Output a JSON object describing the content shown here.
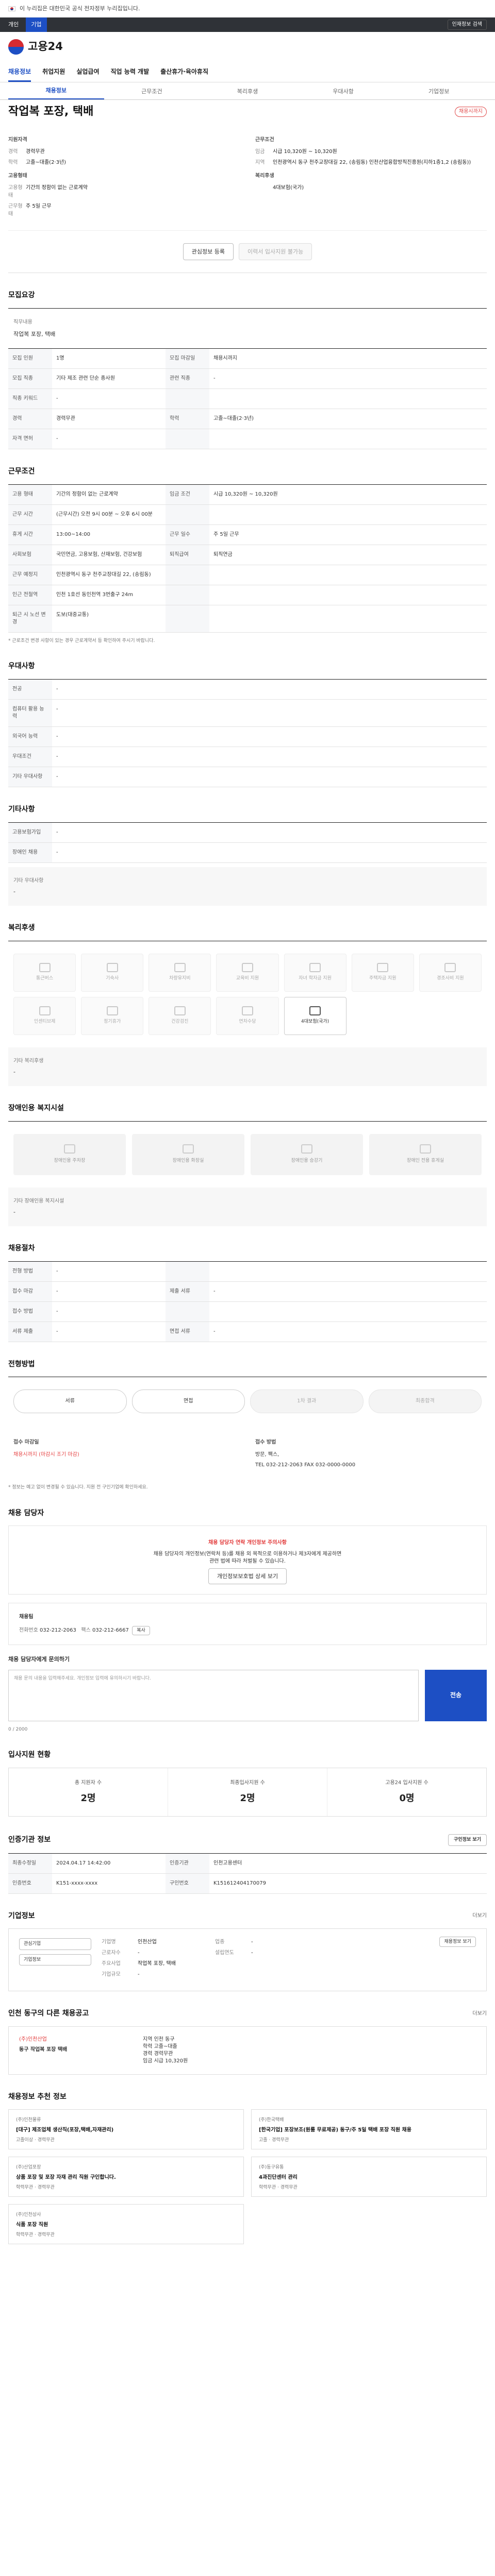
{
  "gov_banner": {
    "text": "이 누리집은 대한민국 공식 전자정부 누리집입니다.",
    "more": "",
    "right": ""
  },
  "util": {
    "tab1": "개인",
    "tab2": "기업",
    "chip": "인재정보 검색"
  },
  "logo": "고용24",
  "gnb": [
    "채용정보",
    "취업지원",
    "실업급여",
    "직업 능력 개발",
    "출산휴가·육아휴직"
  ],
  "subtabs": [
    "채용정보",
    "근무조건",
    "복리후생",
    "우대사항",
    "기업정보"
  ],
  "posting": {
    "title": "작업복 포장, 택배",
    "badge": "채용시까지"
  },
  "summary": {
    "left_h": "지원자격",
    "rows_left": [
      [
        "경력",
        "경력무관"
      ],
      [
        "학력",
        "고졸~대졸(2·3년)"
      ]
    ],
    "left_h2": "고용형태",
    "rows_left2": [
      [
        "고용형태",
        "기간의 정함이 없는 근로계약"
      ],
      [
        "근무형태",
        "주 5일 근무"
      ]
    ],
    "right_h": "근무조건",
    "rows_right": [
      [
        "임금",
        "시급 10,320원 ~ 10,320원"
      ],
      [
        "지역",
        "인천광역시 동구 천주교장대길 22, (송림동) 인천산업융합방직진흥원(지하1층1,2 (송림동))"
      ]
    ],
    "right_h2": "복리후생",
    "rows_right2": [
      [
        "",
        "4대보험(국가)"
      ]
    ]
  },
  "buttons": {
    "save": "관심정보 등록",
    "apply": "이력서 입사지원 불가능"
  },
  "sec_detail": {
    "h": "모집요강",
    "k": "직무내용",
    "v": "작업복 포장, 택배"
  },
  "recruit_table": [
    [
      "모집 인원",
      "1명",
      "모집 마감일",
      "채용시까지"
    ],
    [
      "모집 직종",
      "기타 제조 관련 단순 종사원",
      "관련 직종",
      "-"
    ],
    [
      "직종 키워드",
      "-",
      "",
      ""
    ],
    [
      "경력",
      "경력무관",
      "학력",
      "고졸~대졸(2·3년)"
    ],
    [
      "자격 면허",
      "-",
      "",
      ""
    ]
  ],
  "sec_cond": {
    "h": "근무조건"
  },
  "cond_table": [
    [
      "고용 형태",
      "기간의 정함이 없는 근로계약",
      "임금 조건",
      "시급 10,320원 ~ 10,320원"
    ],
    [
      "근무 시간",
      "(근무시간) 오전 9시 00분 ~ 오후 6시 00분",
      "",
      ""
    ],
    [
      "휴게 시간",
      "13:00~14:00",
      "근무 일수",
      "주 5일 근무"
    ],
    [
      "사회보험",
      "국민연금, 고용보험, 산재보험, 건강보험",
      "퇴직급여",
      "퇴직연금"
    ],
    [
      "근무 예정지",
      "인천광역시 동구 천주교장대길 22, (송림동)",
      "",
      ""
    ],
    [
      "인근 전철역",
      "인천 1호선 동인천역 3번출구 24m",
      "",
      ""
    ],
    [
      "퇴근 시 노선 변경",
      "도보(대중교통)",
      "",
      ""
    ]
  ],
  "cond_note": "* 근로조건 변경 사항이 있는 경우 근로계약서 등 확인하여 주시기 바랍니다.",
  "sec_pref": {
    "h": "우대사항"
  },
  "pref_table": [
    [
      "전공",
      "-"
    ],
    [
      "컴퓨터 활용 능력",
      "-"
    ],
    [
      "외국어 능력",
      "-"
    ],
    [
      "우대조건",
      "-"
    ],
    [
      "기타 우대사항",
      "-"
    ]
  ],
  "sec_etc": {
    "h": "기타사항"
  },
  "etc_table": [
    [
      "고용보험가입",
      "-"
    ],
    [
      "장애인 채용",
      "-"
    ]
  ],
  "etc_box": {
    "k": "기타 우대사항",
    "v": "-"
  },
  "sec_welfare": {
    "h": "복리후생"
  },
  "welfare_items": [
    "통근버스",
    "기숙사",
    "차량유지비",
    "교육비 지원",
    "자녀 학자금 지원",
    "주택자금 지원",
    "경조사비 지원",
    "인센티브제",
    "정기휴가",
    "건강검진",
    "연차수당",
    "4대보험(국가)",
    "",
    ""
  ],
  "welfare_box": {
    "k": "기타 복리후생",
    "v": "-"
  },
  "sec_facility": {
    "h": "장애인용 복지시설"
  },
  "facility_items": [
    "장애인용 주차장",
    "장애인용 화장실",
    "장애인용 승강기",
    "장애인 전용 휴게실"
  ],
  "facility_box": {
    "k": "기타 장애인용 복지시설",
    "v": "-"
  },
  "sec_proc": {
    "h": "채용절차"
  },
  "proc_table": [
    [
      "전형 방법",
      "-",
      "",
      ""
    ],
    [
      "접수 마감",
      "-",
      "제출 서류",
      "-"
    ],
    [
      "접수 방법",
      "-",
      "",
      ""
    ],
    [
      "서류 제출",
      "-",
      "면접 서류",
      "-"
    ]
  ],
  "sec_apply": {
    "h": "전형방법"
  },
  "steps": [
    "서류",
    "면접",
    "1차 결과",
    "최종합격"
  ],
  "method": {
    "lbl1": "접수 마감일",
    "v1": "채용시까지 (마감시 조기 마감)",
    "lbl2": "접수 방법",
    "v2": "방문, 팩스,",
    "v3": "TEL 032-212-2063 FAX 032-0000-0000"
  },
  "method_notes": "* 정보는 예고 없이 변경될 수 있습니다. 지원 전 구인기업에 확인하세요.",
  "sec_contact": {
    "h": "채용 담당자"
  },
  "alert": {
    "title": "채용 담당자 연락 개인정보 주의사항",
    "line1": "채용 담당자의 개인정보(연락처 등)를 채용 외 목적으로 이용하거나 제3자에게 제공하면",
    "line2": "관련 법에 따라 처벌될 수 있습니다.",
    "btn": "개인정보보호법 상세 보기"
  },
  "contact": {
    "name": "채용팀",
    "phone_k": "전화번호",
    "phone": "032-212-2063",
    "fax_k": "팩스",
    "fax": "032-212-6667",
    "btn": "복사"
  },
  "ask": {
    "h": "채용 담당자에게 문의하기",
    "ph": "채용 문의 내용을 입력해주세요. 개인정보 입력에 유의하시기 바랍니다.",
    "btn": "전송",
    "count": "0 / 2000"
  },
  "stats_h": "입사지원 현황",
  "stats": [
    [
      "총 지원자 수",
      "2명"
    ],
    [
      "최종입사지원 수",
      "2명"
    ],
    [
      "고용24 입사지원 수",
      "0명"
    ]
  ],
  "sec_info": {
    "h": "인증기관 정보",
    "btn": "구인정보 보기"
  },
  "info_table": [
    [
      "최종수정일",
      "2024.04.17 14:42:00",
      "인증기관",
      "인천고용센터"
    ],
    [
      "인증번호",
      "K151-xxxx-xxxx",
      "구인번호",
      "K151612404170079"
    ]
  ],
  "sec_company": {
    "h": "기업정보",
    "more": "더보기"
  },
  "company": {
    "name": "",
    "rows": [
      [
        "기업명",
        "인천산업",
        "업종",
        "-"
      ],
      [
        "근로자수",
        "-",
        "설립연도",
        "-"
      ],
      [
        "주요사업",
        "작업복 포장, 택배",
        "",
        ""
      ],
      [
        "기업규모",
        "-",
        "",
        ""
      ]
    ],
    "btn1": "관심기업",
    "btn2": "기업정보",
    "btn3": "채용정보 보기"
  },
  "sec_jobs": {
    "h": "인천 동구의 다른 채용공고",
    "more": "더보기"
  },
  "jobs_banner": {
    "co": "(주)인천산업",
    "title": "동구 작업복 포장 택배",
    "row1": "지역 인천 동구",
    "row2": "학력 고졸~대졸",
    "row3": "경력 경력무관",
    "row4": "임금 시급 10,320원"
  },
  "recommend_h": "채용정보 추천 정보",
  "recommends": [
    {
      "co": "(주)인천물류",
      "jt": "[대구] 제조업체 생산직(포장,택배,자재관리)",
      "a": "고졸이상",
      "b": "경력무관"
    },
    {
      "co": "(주)한국택배",
      "jt": "[한국기업] 포장보조(원룸 무료제공) 동구/주 5일 택배 포장 직원 채용",
      "a": "고졸",
      "b": "경력무관"
    },
    {
      "co": "(주)산업포장",
      "jt": "상품 포장 및 포장 자재 관리 직원 구인합니다.",
      "a": "학력무관",
      "b": "경력무관"
    },
    {
      "co": "(주)동구유통",
      "jt": "4과진단센터 관리",
      "a": "학력무관",
      "b": "경력무관"
    },
    {
      "co": "(주)인천상사",
      "jt": "식품 포장 직원",
      "a": "학력무관",
      "b": "경력무관"
    }
  ]
}
